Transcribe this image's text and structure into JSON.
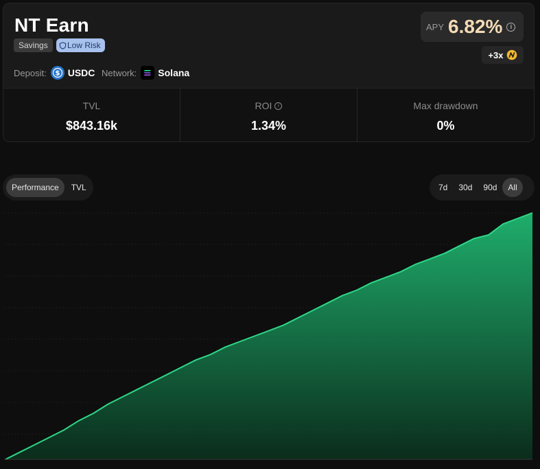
{
  "vault": {
    "title": "NT Earn",
    "tags": {
      "savings": "Savings",
      "risk": "Low Risk"
    },
    "deposit_label": "Deposit:",
    "deposit_asset": "USDC",
    "network_label": "Network:",
    "network": "Solana",
    "apy_label": "APY",
    "apy_value": "6.82%",
    "boost": "+3x"
  },
  "stats": [
    {
      "label": "TVL",
      "value": "$843.16k"
    },
    {
      "label": "ROI",
      "value": "1.34%"
    },
    {
      "label": "Max drawdown",
      "value": "0%"
    }
  ],
  "chart_tabs": {
    "performance": "Performance",
    "tvl": "TVL",
    "selected": "Performance"
  },
  "range_tabs": {
    "d7": "7d",
    "d30": "30d",
    "d90": "90d",
    "all": "All",
    "selected": "All"
  },
  "colors": {
    "accent_green": "#22c27a",
    "apy_gold": "#f4dbb6",
    "risk_badge": "#a8c2ee",
    "usdc_blue": "#2775ca"
  },
  "chart_data": {
    "type": "area",
    "title": "",
    "xlabel": "",
    "ylabel": "",
    "grid": true,
    "values": [
      0.0,
      0.04,
      0.08,
      0.12,
      0.16,
      0.21,
      0.25,
      0.3,
      0.34,
      0.38,
      0.42,
      0.46,
      0.5,
      0.54,
      0.57,
      0.61,
      0.64,
      0.67,
      0.7,
      0.73,
      0.77,
      0.81,
      0.85,
      0.89,
      0.92,
      0.96,
      0.99,
      1.02,
      1.06,
      1.09,
      1.12,
      1.16,
      1.2,
      1.22,
      1.28,
      1.31,
      1.34
    ]
  }
}
